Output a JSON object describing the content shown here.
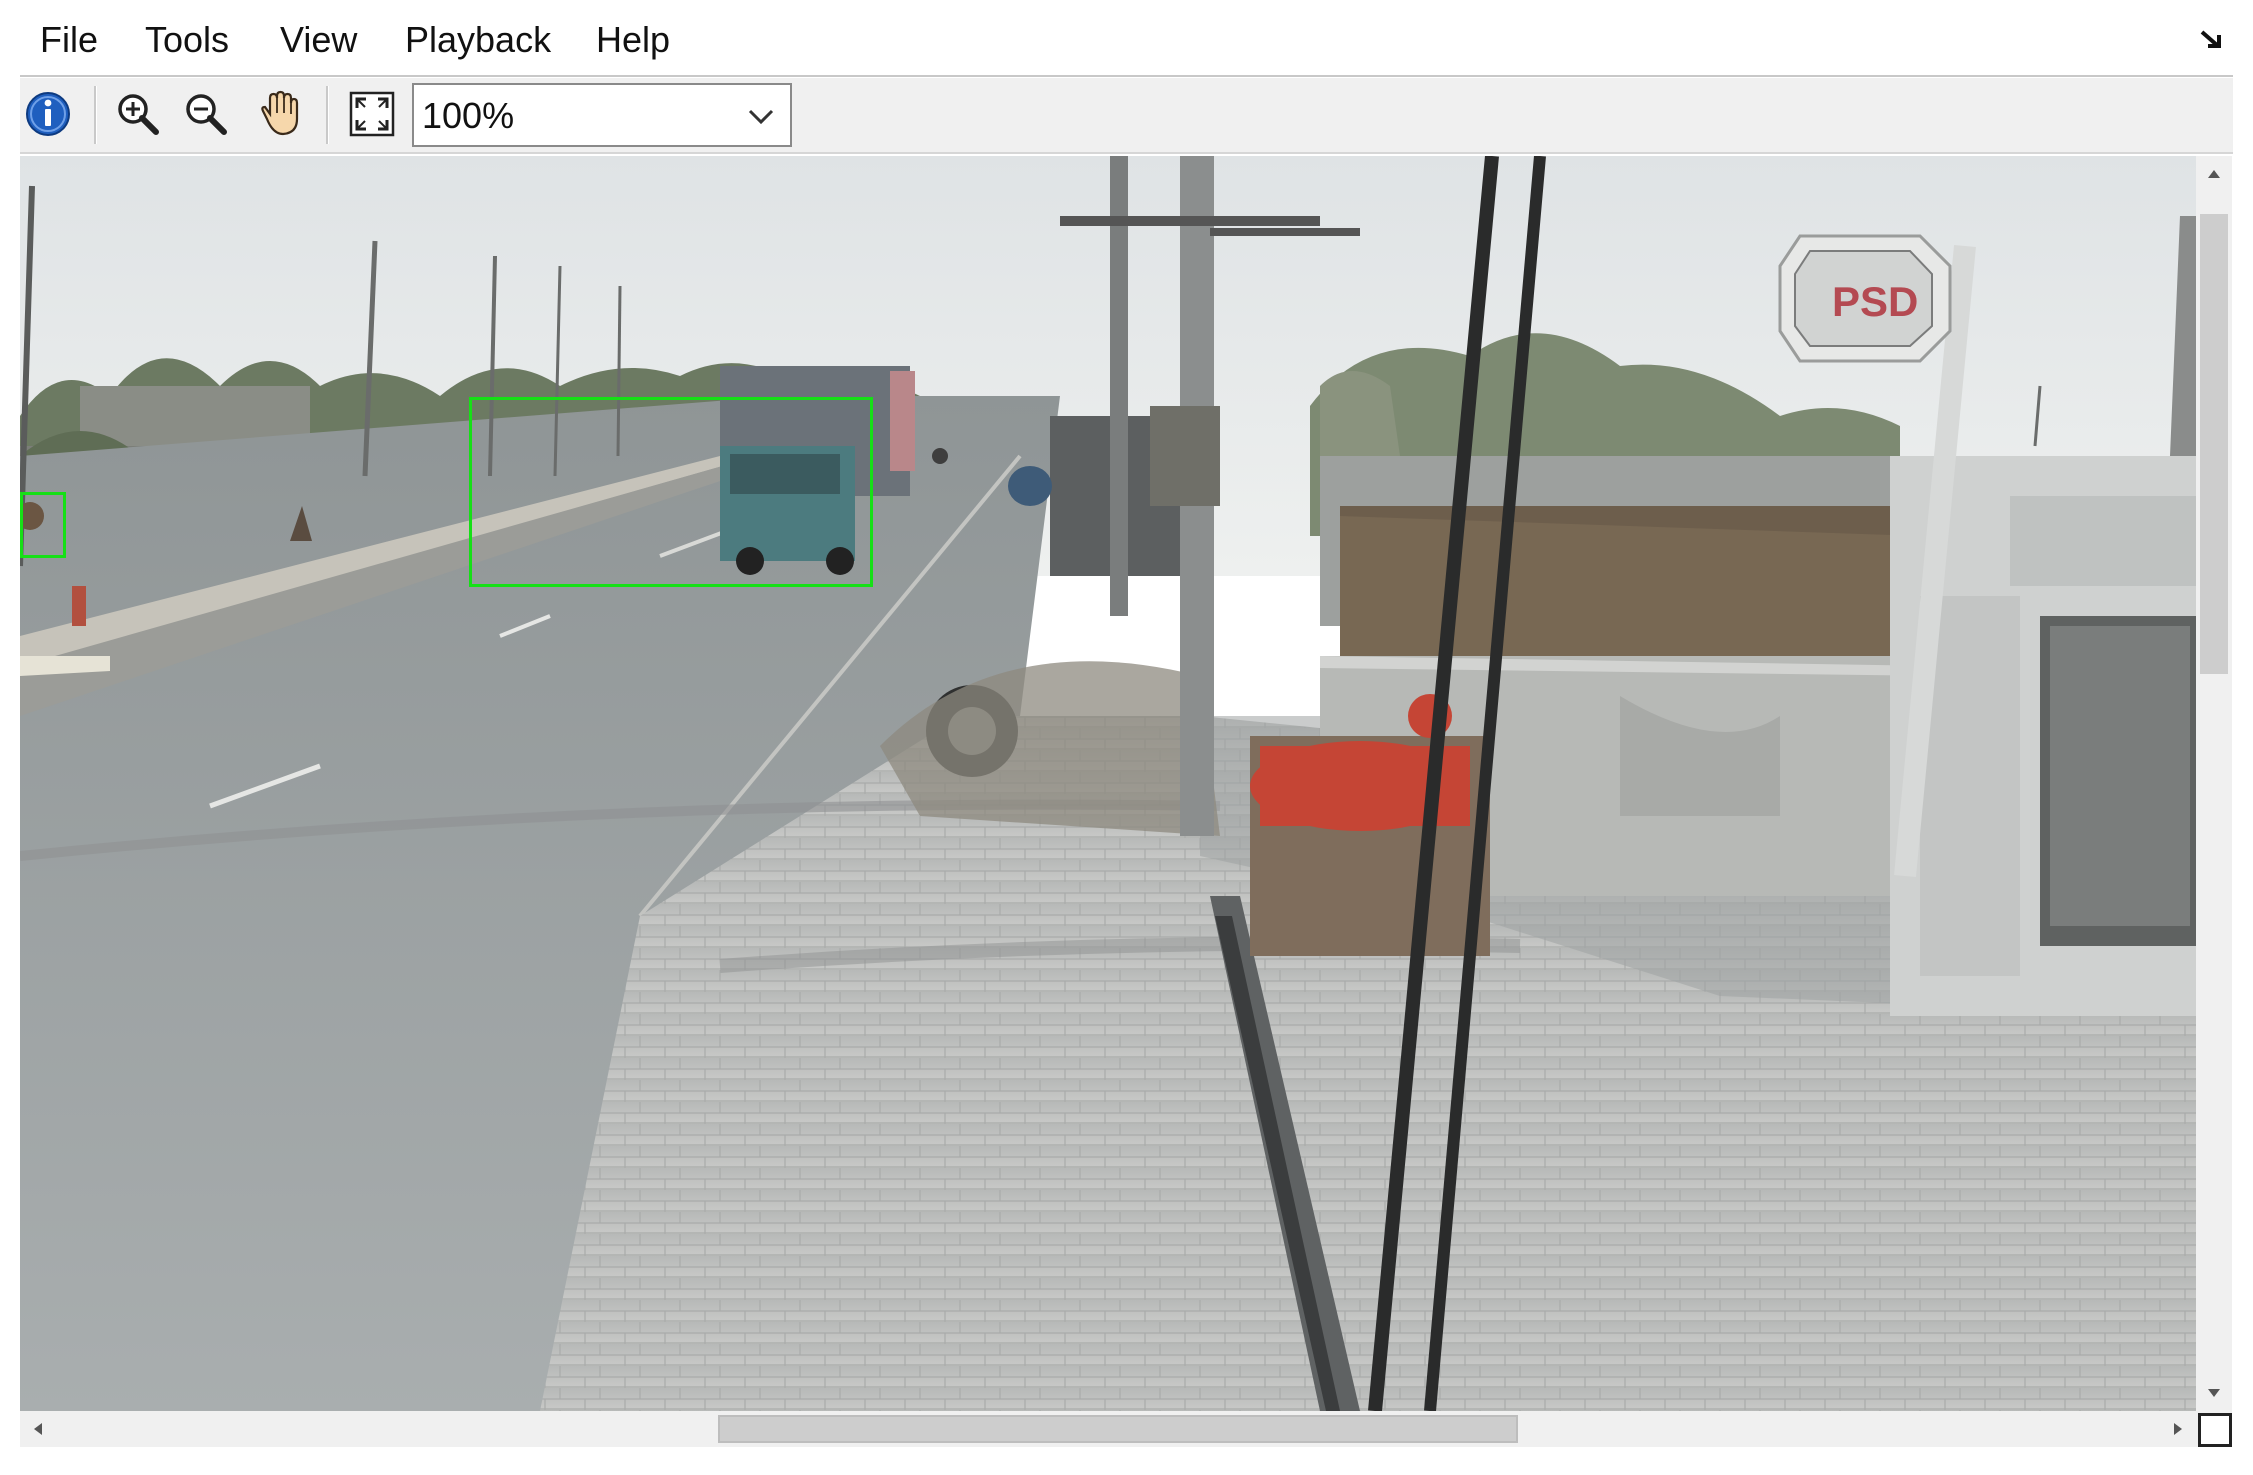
{
  "menu": {
    "file": "File",
    "tools": "Tools",
    "view": "View",
    "playback": "Playback",
    "help": "Help"
  },
  "toolbar": {
    "icons": [
      "info-icon",
      "zoom-in-icon",
      "zoom-out-icon",
      "pan-hand-icon",
      "fit-to-window-icon"
    ],
    "zoom_value": "100%"
  },
  "video": {
    "sign_text": "PSD",
    "detection_color": "#16e016",
    "detections": 2
  },
  "colors": {
    "menubar_bg": "#ffffff",
    "toolbar_bg": "#f0f0f0",
    "info_blue": "#1f5fbf",
    "bbox_green": "#16e016"
  }
}
